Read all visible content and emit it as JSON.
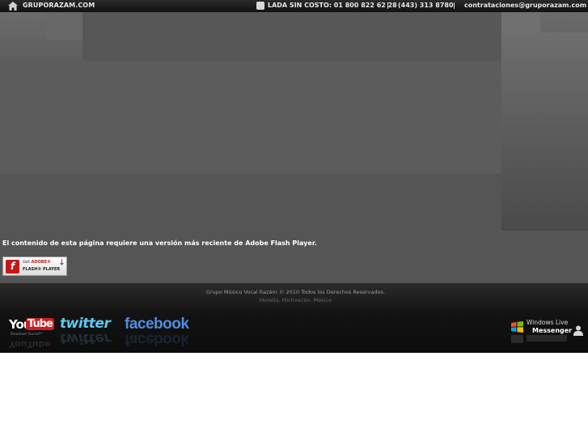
{
  "topbar": {
    "site": "GRUPORAZAM.COM",
    "phone": "LADA SIN COSTO: 01 800  822 62 28",
    "separator": "|",
    "phone2": "(443) 313 8780",
    "email": "contrataciones@gruporazam.com",
    "icons": [
      "home-icon",
      "phone-icon"
    ]
  },
  "flash": {
    "message": "El contenido de esta página requiere una versión más reciente de Adobe Flash Player.",
    "badge_get": "Get",
    "badge_adobe": "ADOBE®",
    "badge_product": "FLASH® PLAYER",
    "logo_glyph": "f"
  },
  "footer": {
    "copyright": "Grupo Músico Vocal Razám  ©  2010  Todos los Derechos Reservados.",
    "location": "Morelia, Michoacán. México"
  },
  "social": {
    "youtube_you": "You",
    "youtube_tube": "Tube",
    "youtube_tagline": "Broadcast Yourself™",
    "twitter": "twitter",
    "facebook": "facebook",
    "messenger_top": "Windows Live",
    "messenger_bottom": "Messenger"
  },
  "colors": {
    "background": "#5a5a5a",
    "topbar": "#111111",
    "twitter": "#5ec8f0",
    "facebook": "#4f8ee0",
    "youtube_red": "#cc1f1f",
    "flash_red": "#c81717"
  }
}
